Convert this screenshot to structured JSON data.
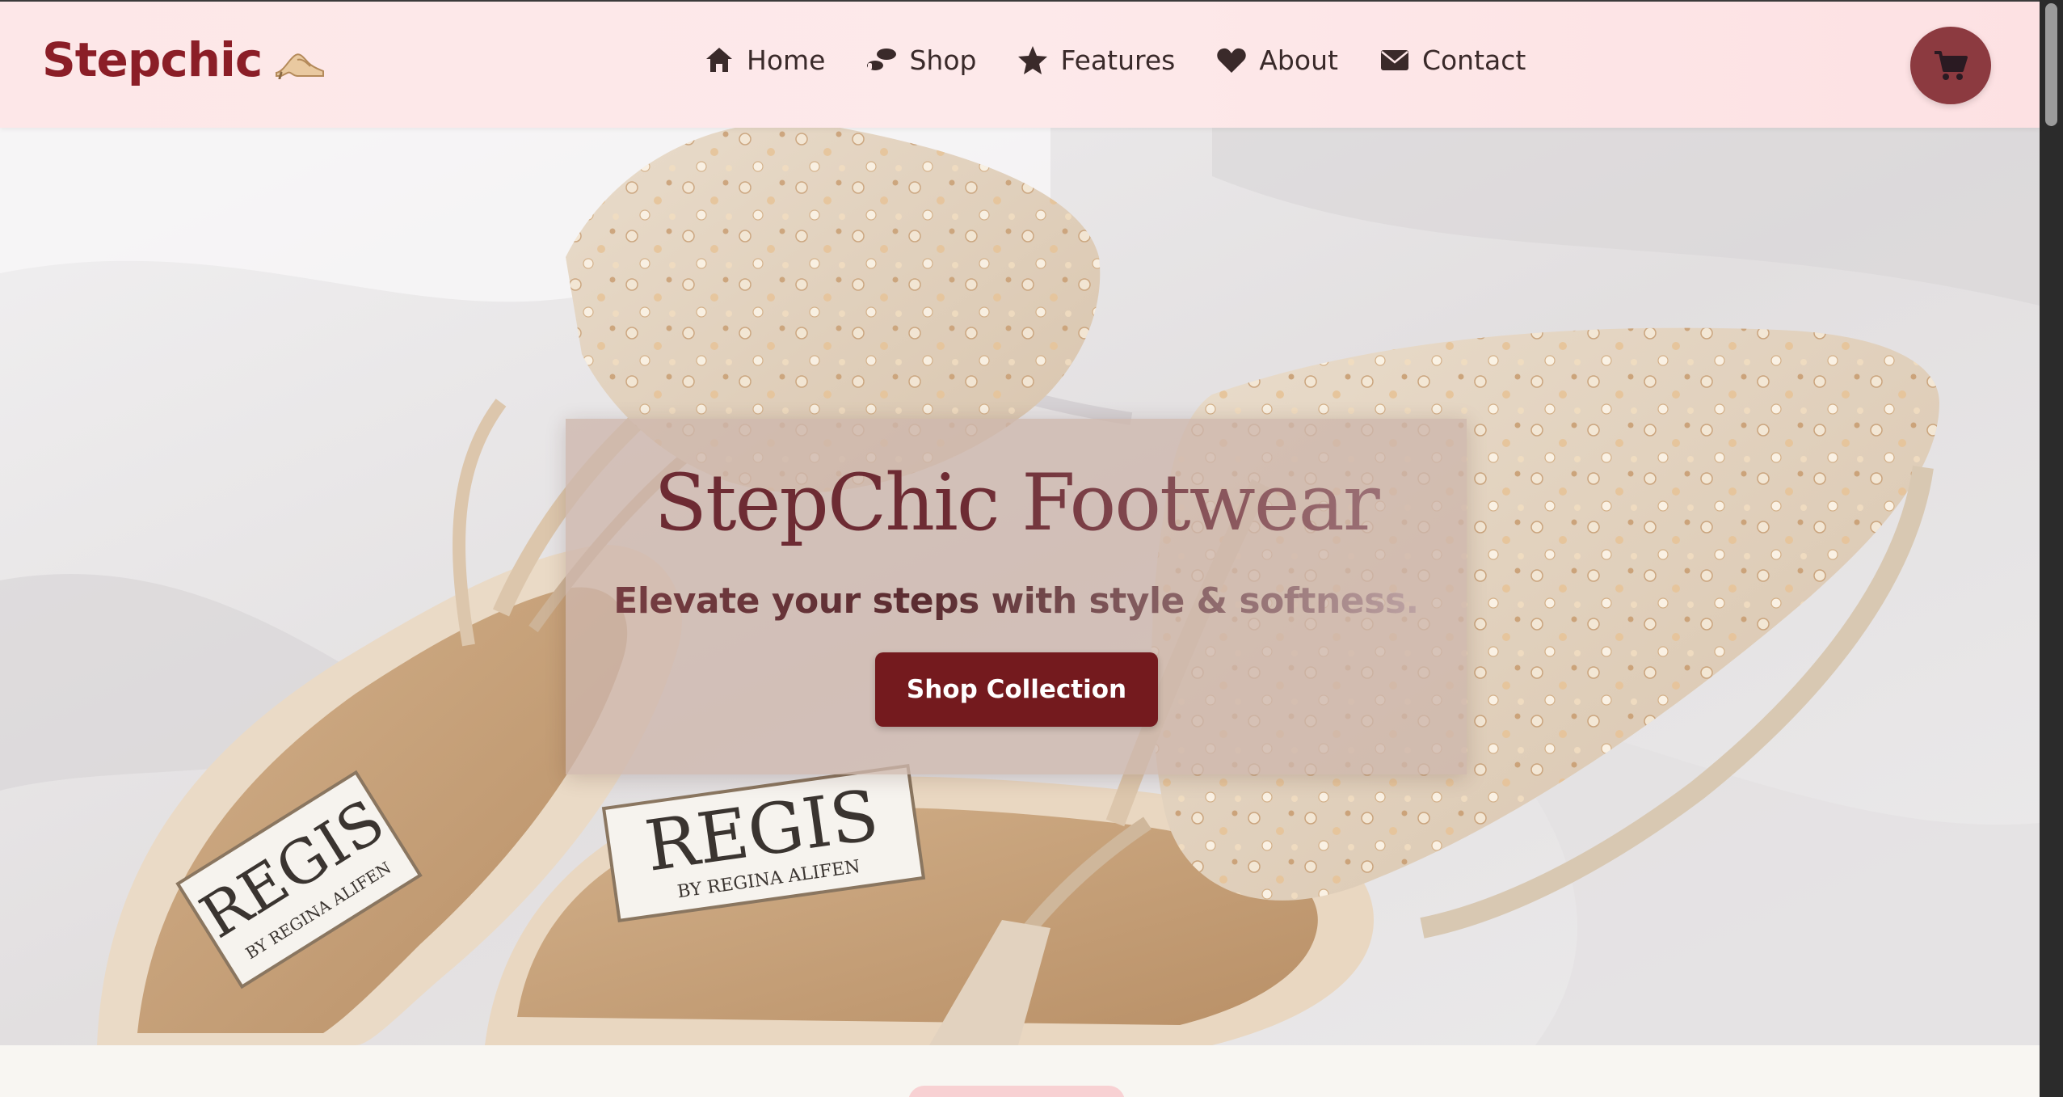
{
  "header": {
    "brand": "Stepchic",
    "brand_emoji": "high-heel-icon",
    "nav": [
      {
        "label": "Home",
        "icon": "home-icon"
      },
      {
        "label": "Shop",
        "icon": "shoe-prints-icon"
      },
      {
        "label": "Features",
        "icon": "star-icon"
      },
      {
        "label": "About",
        "icon": "heart-icon"
      },
      {
        "label": "Contact",
        "icon": "envelope-icon"
      }
    ],
    "cart_icon": "shopping-cart-icon"
  },
  "hero": {
    "title": "StepChic Footwear",
    "subtitle": "Elevate your steps with style & softness.",
    "cta_label": "Shop Collection",
    "image": "embellished-beige-mules-photo",
    "insole_brand_text": "REGIS",
    "insole_sub_text": "BY REGINA ALIFEN"
  },
  "colors": {
    "brand": "#8b1e27",
    "nav_background": "#fde7e8",
    "cart_button": "#8c3a40",
    "cta_button": "#741a1e",
    "page_background": "#f8f6f2",
    "section_pill": "#f8d1d3"
  }
}
